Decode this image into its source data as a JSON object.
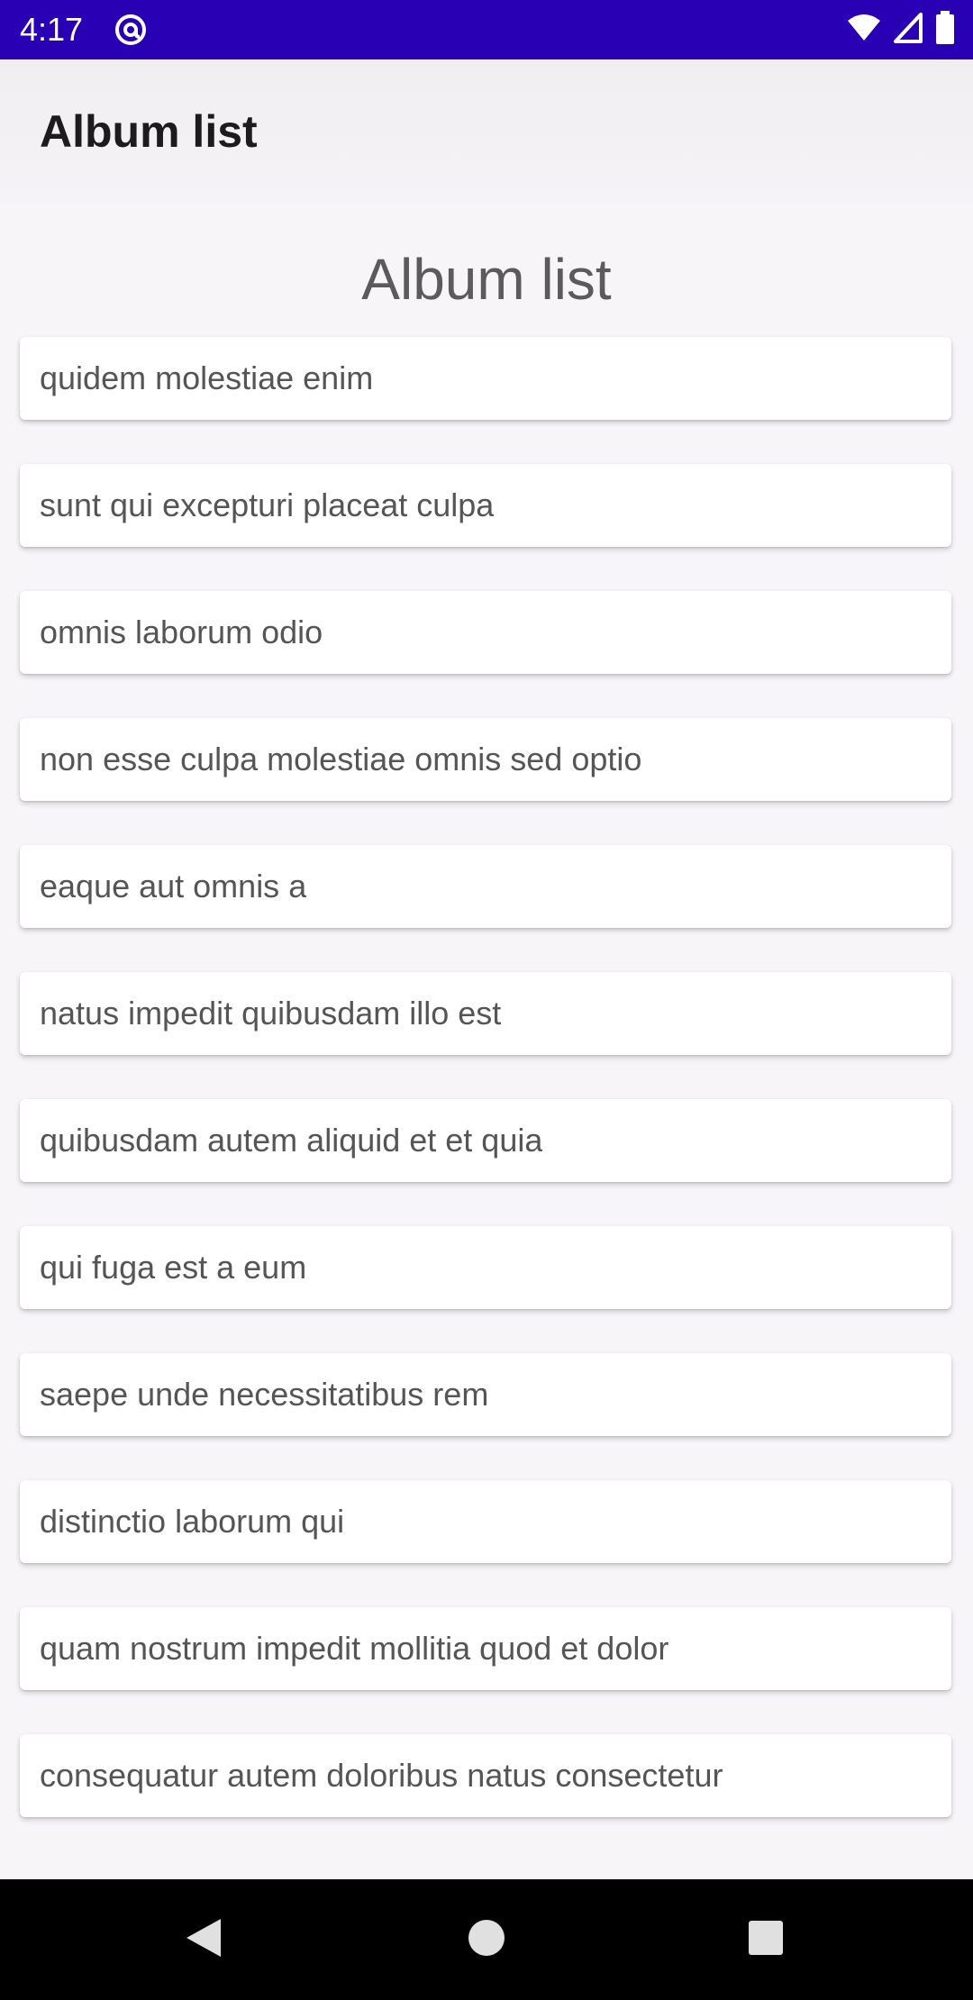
{
  "status_bar": {
    "time": "4:17",
    "app_icon": "at-sign-icon",
    "icons": [
      "wifi-icon",
      "signal-icon",
      "battery-icon"
    ],
    "background_color": "#2a00b5"
  },
  "app_bar": {
    "title": "Album list"
  },
  "main": {
    "heading": "Album list",
    "albums": [
      "quidem molestiae enim",
      "sunt qui excepturi placeat culpa",
      "omnis laborum odio",
      "non esse culpa molestiae omnis sed optio",
      "eaque aut omnis a",
      "natus impedit quibusdam illo est",
      "quibusdam autem aliquid et et quia",
      "qui fuga est a eum",
      "saepe unde necessitatibus rem",
      "distinctio laborum qui",
      "quam nostrum impedit mollitia quod et dolor",
      "consequatur autem doloribus natus consectetur"
    ]
  },
  "nav_bar": {
    "buttons": [
      "back-icon",
      "home-icon",
      "recents-icon"
    ]
  }
}
